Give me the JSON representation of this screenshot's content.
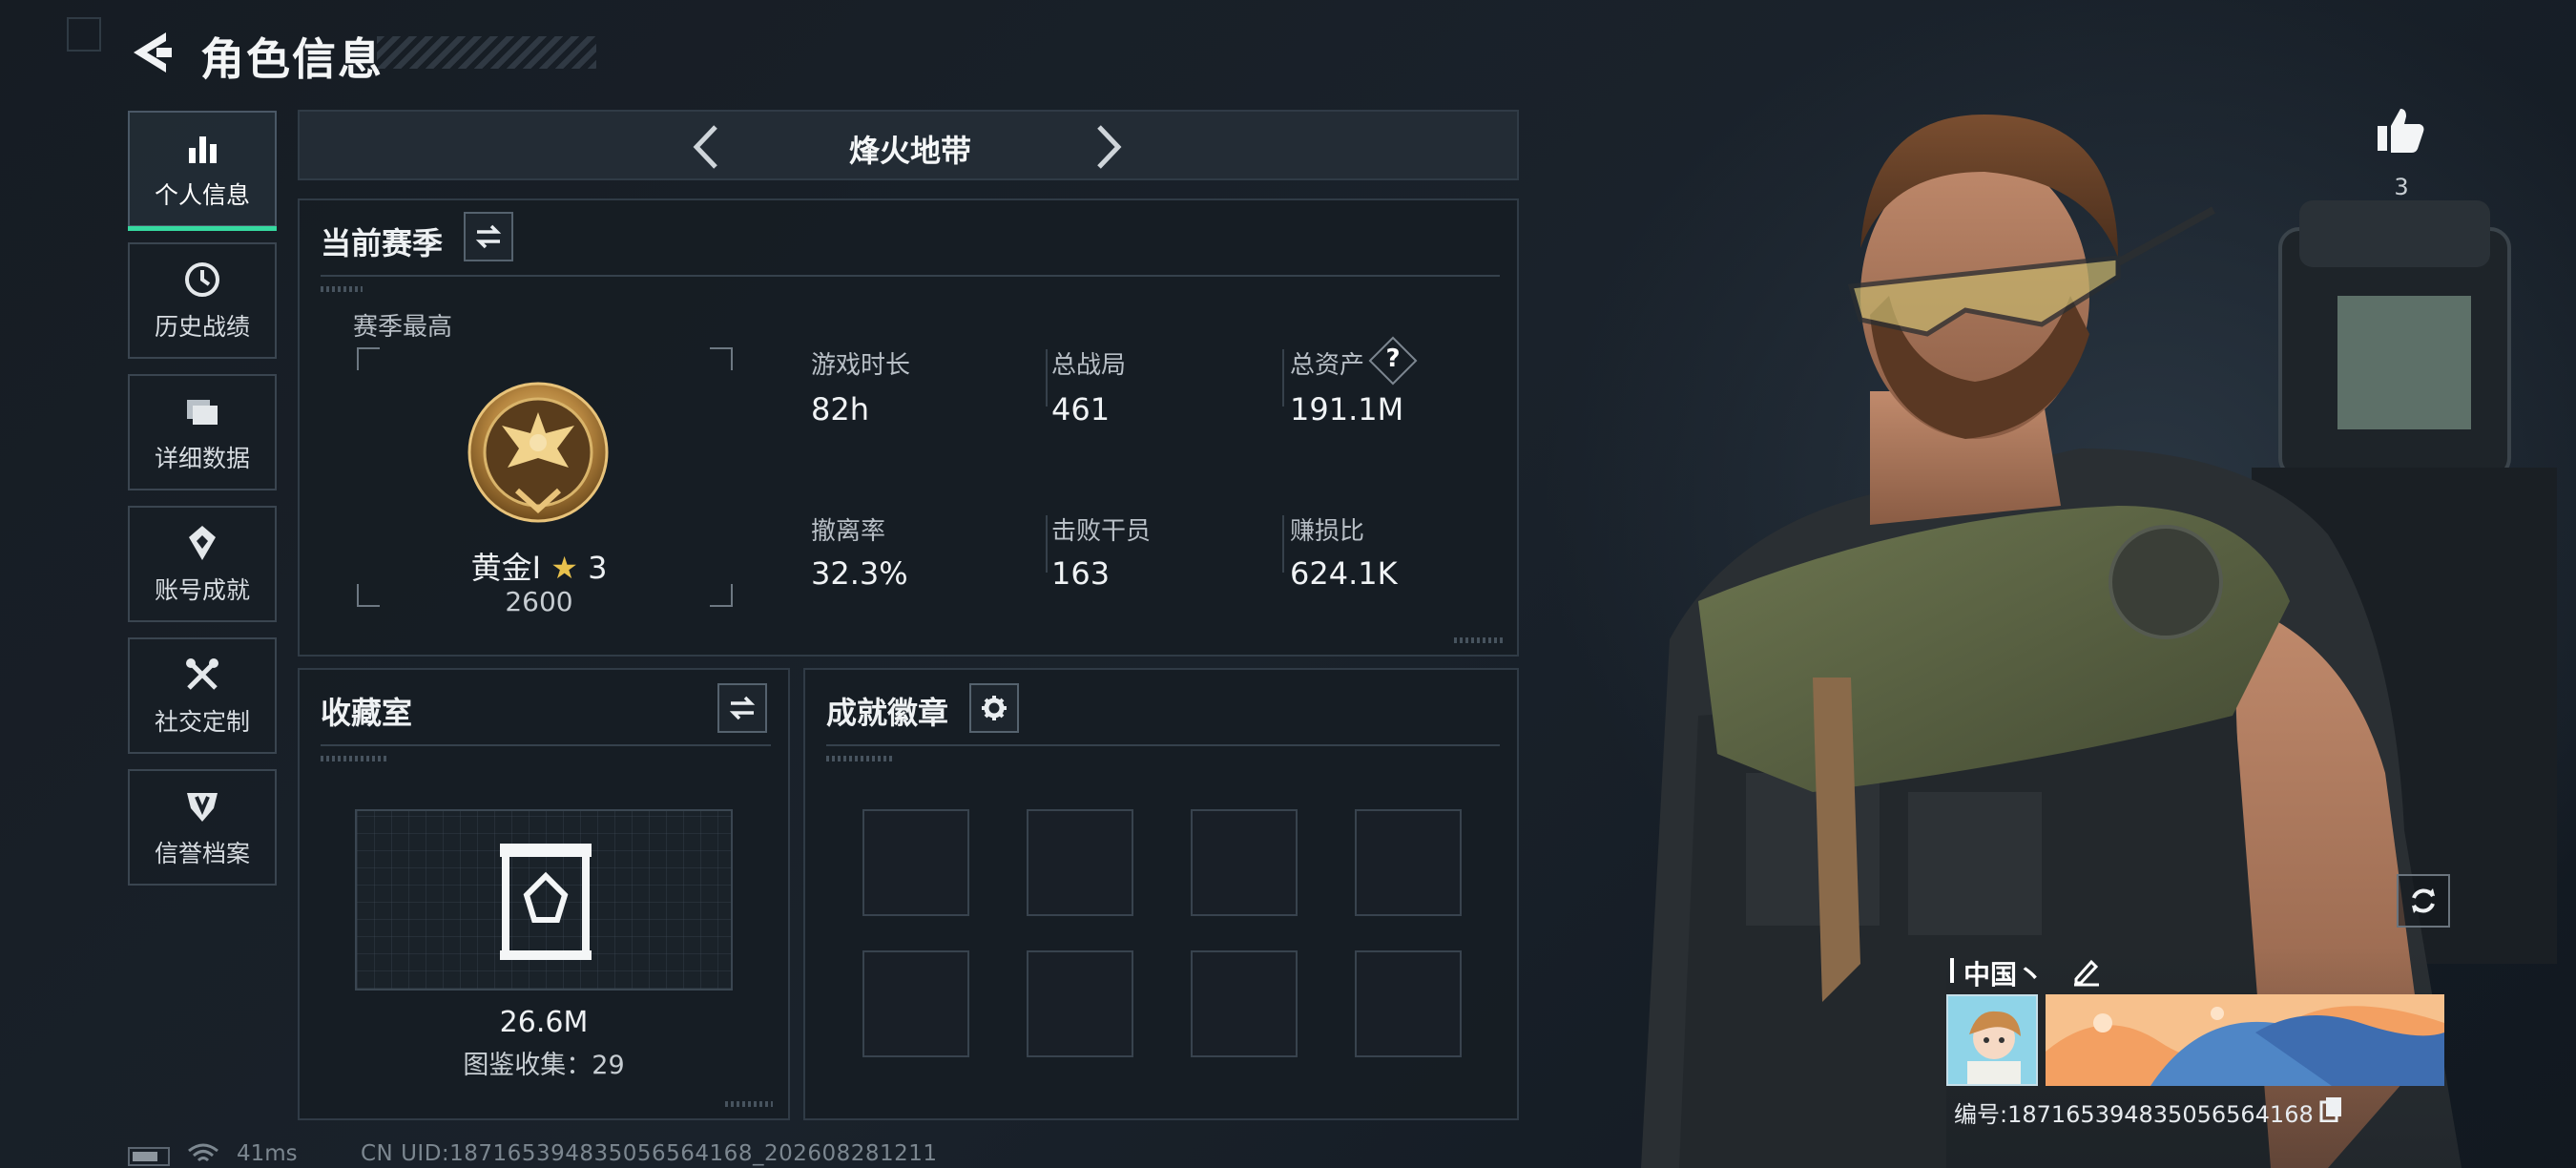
{
  "header": {
    "title": "角色信息",
    "back_icon": "back-arrow-icon"
  },
  "sidebar": {
    "items": [
      {
        "label": "个人信息",
        "icon": "bar-chart-icon",
        "active": true
      },
      {
        "label": "历史战绩",
        "icon": "clock-icon",
        "active": false
      },
      {
        "label": "详细数据",
        "icon": "folder-icon",
        "active": false
      },
      {
        "label": "账号成就",
        "icon": "achievement-icon",
        "active": false
      },
      {
        "label": "社交定制",
        "icon": "tools-icon",
        "active": false
      },
      {
        "label": "信誉档案",
        "icon": "shield-icon",
        "active": false
      }
    ],
    "accent_color": "#36d9a0"
  },
  "mode": {
    "name": "烽火地带"
  },
  "season": {
    "title": "当前赛季",
    "peak_label": "赛季最高",
    "rank_name": "黄金Ⅰ",
    "rank_stars": "3",
    "rank_score": "2600",
    "stats": [
      {
        "label": "游戏时长",
        "value": "82h"
      },
      {
        "label": "总战局",
        "value": "461"
      },
      {
        "label": "总资产",
        "value": "191.1M",
        "help": "?"
      },
      {
        "label": "撤离率",
        "value": "32.3%"
      },
      {
        "label": "击败干员",
        "value": "163"
      },
      {
        "label": "赚损比",
        "value": "624.1K"
      }
    ]
  },
  "collection": {
    "title": "收藏室",
    "value": "26.6M",
    "catalog_text": "图鉴收集：29"
  },
  "achievements": {
    "title": "成就徽章",
    "slot_count": 8
  },
  "profile": {
    "likes": "3",
    "region_name": "中国丶",
    "id_text": "编号:18716539483505656416​8"
  },
  "footer": {
    "ping": "41ms",
    "uid_text": "CN UID:18716539483505656416​8_202608281211"
  }
}
